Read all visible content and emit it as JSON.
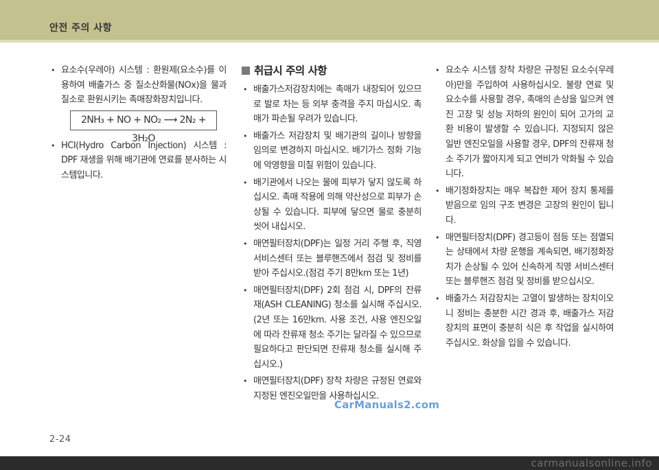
{
  "header": {
    "title": "안전 주의 사항"
  },
  "left_column": {
    "items": [
      "요소수(우레아) 시스템 : 환원제(요소수)를 이용하여 배출가스 중 질소산화물(NOx)을 물과 질소로 환원시키는 촉매장화장치입니다.",
      "HCI(Hydro Carbon Injection) 시스템 : DPF 재생을 위해 배기관에 연료를 분사하는 시스템입니다."
    ],
    "formula": "2NH₃ + NO + NO₂ ⟶ 2N₂ + 3H₂O"
  },
  "middle_column": {
    "heading": "취급시 주의 사항",
    "items": [
      "배출가스저감장치에는 촉매가 내장되어 있으므로 발로 차는 등 외부 충격을 주지 마십시오. 촉매가 파손될 우려가 있습니다.",
      "배출가스 저감장치 및 배기관의 길이나 방향을 임의로 변경하지 마십시오. 배기가스 정화 기능에 악영향을 미칠 위험이 있습니다.",
      "배기관에서 나오는 물에 피부가 닿지 않도록 하십시오. 촉매 작용에 의해 약산성으로 피부가 손상될 수 있습니다. 피부에 닿으면 물로 충분히 씻어 내십시오.",
      "매연필터장치(DPF)는 일정 거리 주행 후, 직영 서비스센터 또는 블루핸즈에서 점검 및 정비를 받아 주십시오.(점검 주기 8만km 또는 1년)",
      "매연필터장치(DPF) 2회 점검 시, DPF의 잔류재(ASH CLEANING) 청소를 실시해 주십시오.(2년 또는 16만km. 사용 조건, 사용 엔진오일에 따라 잔류재 청소 주기는 달라질 수 있으므로 필요하다고 판단되면 잔류재 청소를 실시해 주십시오.)",
      "매연필터장치(DPF) 장착 차량은 규정된 연료와 지정된 엔진오일만을 사용하십시오."
    ]
  },
  "right_column": {
    "items": [
      "요소수 시스템 장착 차량은 규정된 요소수(우레아)만을 주입하여 사용하십시오. 불량 연료 및 요소수를 사용할 경우, 촉매의 손상을 일으켜 엔진 고장 및 성능 저하의 원인이 되어 고가의 교환 비용이 발생할 수 있습니다. 지정되지 않은 일반 엔진오일을 사용할 경우, DPF의 잔류재 청소 주기가 짧아지게 되고 연비가 악화될 수 있습니다.",
      "배기정화장치는 매우 복잡한 제어 장치 통제를 받음으로 임의 구조 변경은 고장의 원인이 됩니다.",
      "매연필터장치(DPF) 경고등이 점등 또는 점멸되는 상태에서 차량 운행을 계속되면, 배기정화장치가 손상될 수 있어 신속하게 직영 서비스센터 또는 블루핸즈 점검 및 정비를 받으십시오.",
      "배출가스 저감장치는 고열이 발생하는 장치이오니 정비는 충분한 시간 경과 후, 배출가스 저감장치의 표면이 충분히 식은 후 작업을 실시하여 주십시오. 화상을 입을 수 있습니다."
    ]
  },
  "watermark": "CarManuals2.com",
  "page_number": "2-24",
  "footer": {
    "text": "carmanualsonline.info"
  }
}
